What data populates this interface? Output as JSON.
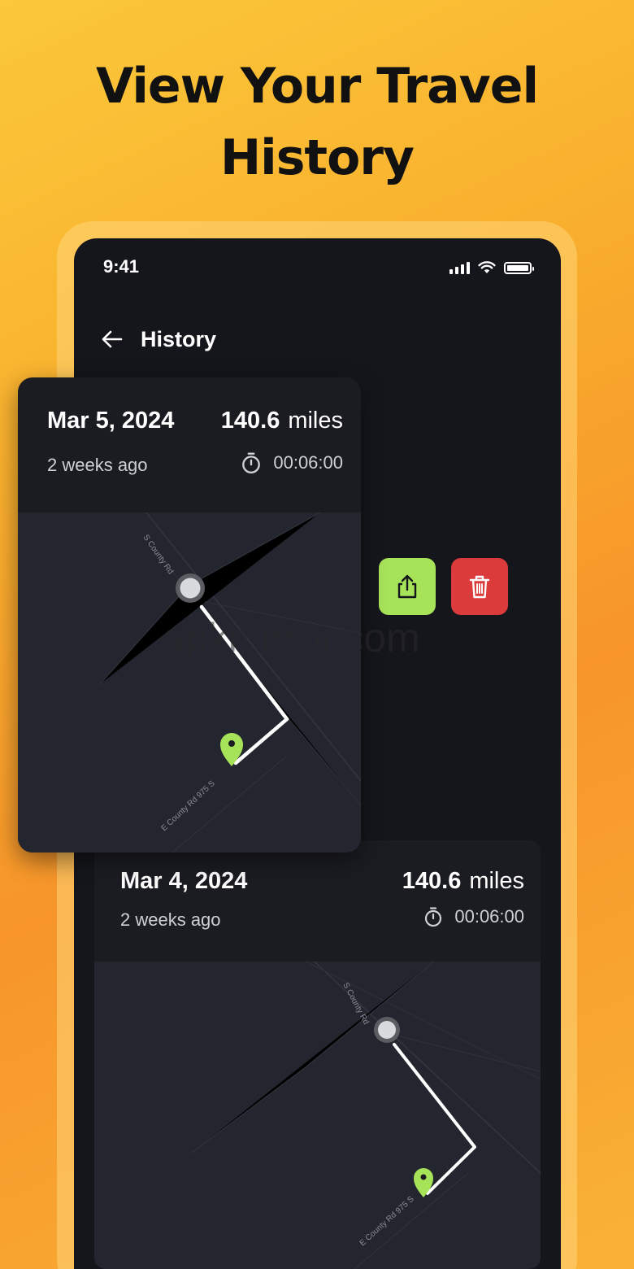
{
  "headline": {
    "line1": "View Your Travel",
    "line2": "History"
  },
  "status_bar": {
    "time": "9:41",
    "icons": [
      "signal-icon",
      "wifi-icon",
      "battery-icon"
    ]
  },
  "nav": {
    "back_icon": "arrow-left-icon",
    "title": "History"
  },
  "actions": {
    "share_icon": "share-icon",
    "delete_icon": "trash-icon",
    "share_color": "#a7e359",
    "delete_color": "#dc3b3c"
  },
  "trips": [
    {
      "date": "Mar 5, 2024",
      "distance_value": "140.6",
      "distance_unit": "miles",
      "ago": "2 weeks ago",
      "duration": "00:06:00",
      "map": {
        "road_label_top": "S County Rd",
        "road_label_bottom": "E County Rd 975 S",
        "start_marker": "start-dot-icon",
        "end_marker": "map-pin-icon"
      }
    },
    {
      "date": "Mar 4, 2024",
      "distance_value": "140.6",
      "distance_unit": "miles",
      "ago": "2 weeks ago",
      "duration": "00:06:00",
      "map": {
        "road_label_top": "S County Rd",
        "road_label_bottom": "E County Rd 975 S",
        "start_marker": "start-dot-icon",
        "end_marker": "map-pin-icon"
      }
    }
  ],
  "watermark": "apkmirror.com",
  "colors": {
    "accent_green": "#a7e359",
    "danger_red": "#dc3b3c",
    "screen_bg": "#15161b",
    "card_bg": "#1b1c22",
    "map_bg": "#23262e"
  }
}
